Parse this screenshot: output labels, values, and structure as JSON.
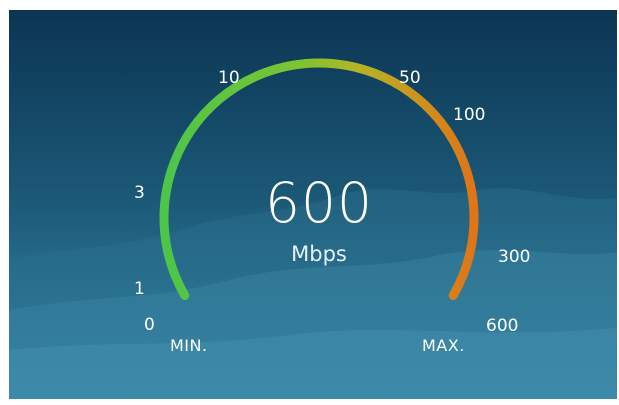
{
  "gauge": {
    "value": "600",
    "unit": "Mbps",
    "level": 1.0,
    "ticks": [
      "0",
      "1",
      "3",
      "10",
      "50",
      "100",
      "300",
      "600"
    ],
    "min_label": "MIN.",
    "max_label": "MAX."
  },
  "colors": {
    "arc_start": "#4cc54a",
    "arc_mid": "#a8b82a",
    "arc_end": "#e07418",
    "text": "#ffffff",
    "sky_top": "#0c3553",
    "sky_bottom": "#3b8fae"
  }
}
